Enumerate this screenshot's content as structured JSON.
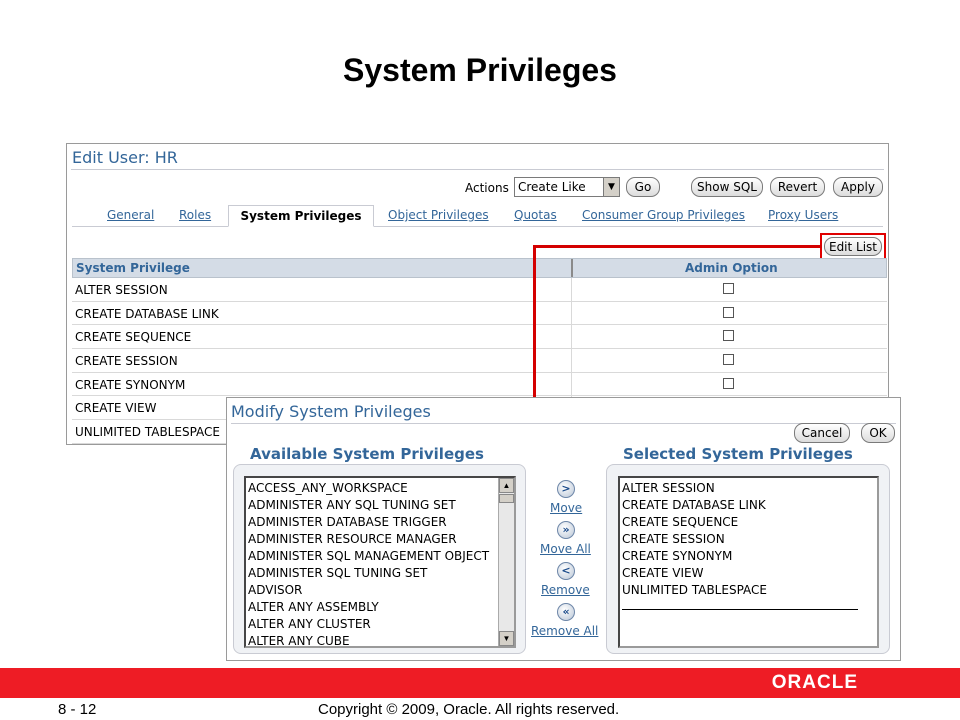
{
  "slide": {
    "title": "System Privileges",
    "page_number": "8 - 12",
    "copyright": "Copyright © 2009, Oracle. All rights reserved.",
    "logo": "ORACLE"
  },
  "edit_user": {
    "title": "Edit User: HR",
    "actions_label": "Actions",
    "actions_select_value": "Create Like",
    "go_label": "Go",
    "show_sql_label": "Show SQL",
    "revert_label": "Revert",
    "apply_label": "Apply",
    "tabs": [
      "General",
      "Roles",
      "System Privileges",
      "Object Privileges",
      "Quotas",
      "Consumer Group Privileges",
      "Proxy Users"
    ],
    "active_tab": "System Privileges",
    "edit_list_label": "Edit List",
    "table": {
      "headers": [
        "System Privilege",
        "Admin Option"
      ],
      "rows": [
        "ALTER SESSION",
        "CREATE DATABASE LINK",
        "CREATE SEQUENCE",
        "CREATE SESSION",
        "CREATE SYNONYM",
        "CREATE VIEW",
        "UNLIMITED TABLESPACE"
      ]
    }
  },
  "modify": {
    "title": "Modify System Privileges",
    "cancel_label": "Cancel",
    "ok_label": "OK",
    "available_title": "Available System Privileges",
    "selected_title": "Selected System Privileges",
    "available": [
      "ACCESS_ANY_WORKSPACE",
      "ADMINISTER ANY SQL TUNING SET",
      "ADMINISTER DATABASE TRIGGER",
      "ADMINISTER RESOURCE MANAGER",
      "ADMINISTER SQL MANAGEMENT OBJECT",
      "ADMINISTER SQL TUNING SET",
      "ADVISOR",
      "ALTER ANY ASSEMBLY",
      "ALTER ANY CLUSTER",
      "ALTER ANY CUBE"
    ],
    "selected": [
      "ALTER SESSION",
      "CREATE DATABASE LINK",
      "CREATE SEQUENCE",
      "CREATE SESSION",
      "CREATE SYNONYM",
      "CREATE VIEW",
      "UNLIMITED TABLESPACE"
    ],
    "move_label": "Move",
    "move_all_label": "Move All",
    "remove_label": "Remove",
    "remove_all_label": "Remove All"
  },
  "colors": {
    "accent": "#336699",
    "highlight": "#e00000",
    "footer": "#ee1c25"
  }
}
